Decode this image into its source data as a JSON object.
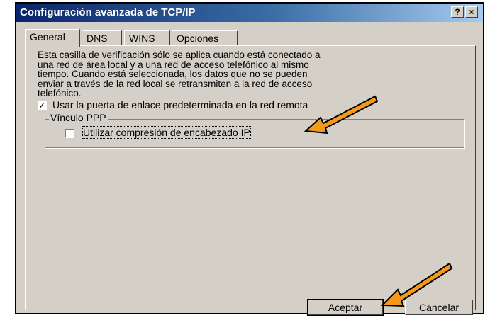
{
  "window": {
    "title": "Configuración avanzada de TCP/IP",
    "help_label": "?",
    "close_label": "×"
  },
  "tabs": [
    {
      "label": "General",
      "active": true
    },
    {
      "label": "DNS",
      "active": false
    },
    {
      "label": "WINS",
      "active": false
    },
    {
      "label": "Opciones",
      "active": false
    }
  ],
  "general": {
    "description": [
      "Esta casilla de verificación sólo se aplica cuando está conectado a",
      "una red de área local y a una red de acceso telefónico al mismo",
      "tiempo. Cuando está seleccionada, los datos que no se pueden",
      "enviar a través de la red local se retransmiten a la red de acceso",
      "telefónico."
    ],
    "gateway_checkbox": {
      "label": "Usar la puerta de enlace predeterminada en la red remota",
      "checked": true,
      "mark": "✓"
    },
    "ppp_group": {
      "title": "Vínculo PPP",
      "compression_checkbox": {
        "label": "Utilizar compresión de encabezado IP",
        "checked": false
      }
    }
  },
  "buttons": {
    "ok": "Aceptar",
    "cancel": "Cancelar"
  },
  "annotation_color": "#f39a1e"
}
